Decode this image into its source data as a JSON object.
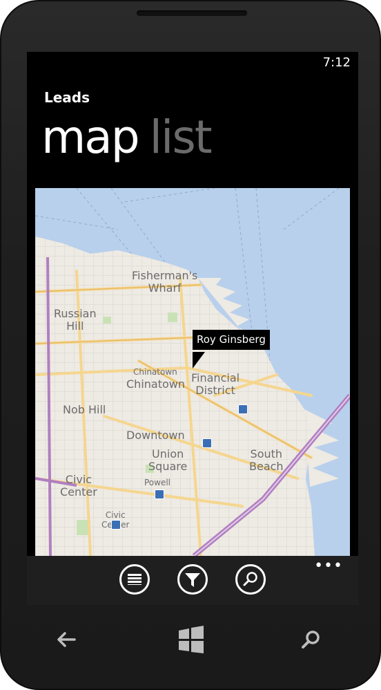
{
  "status_bar": {
    "time": "7:12"
  },
  "app": {
    "title": "Leads"
  },
  "pivot": {
    "items": [
      "map",
      "list"
    ],
    "selected": "map"
  },
  "map": {
    "labels": {
      "fishermans_wharf": "Fisherman's\nWharf",
      "russian_hill": "Russian\nHill",
      "chinatown_small": "Chinatown",
      "chinatown": "Chinatown",
      "financial_district": "Financial\nDistrict",
      "nob_hill": "Nob Hill",
      "downtown": "Downtown",
      "union_square": "Union\nSquare",
      "south_beach": "South\nBeach",
      "powell": "Powell",
      "civic_center": "Civic\nCenter",
      "civic_center_small": "Civic\nCenter"
    },
    "pushpin": {
      "label": "Roy Ginsberg"
    },
    "colors": {
      "water": "#b8d0ec",
      "land": "#eeeae4",
      "major_road": "#f5d68f",
      "freeway": "#b07fc0"
    }
  },
  "appbar": {
    "buttons": [
      "list-icon",
      "filter-icon",
      "search-icon"
    ],
    "more": "•••"
  },
  "hardware": {
    "buttons": [
      "back-icon",
      "windows-start-icon",
      "search-icon"
    ]
  }
}
